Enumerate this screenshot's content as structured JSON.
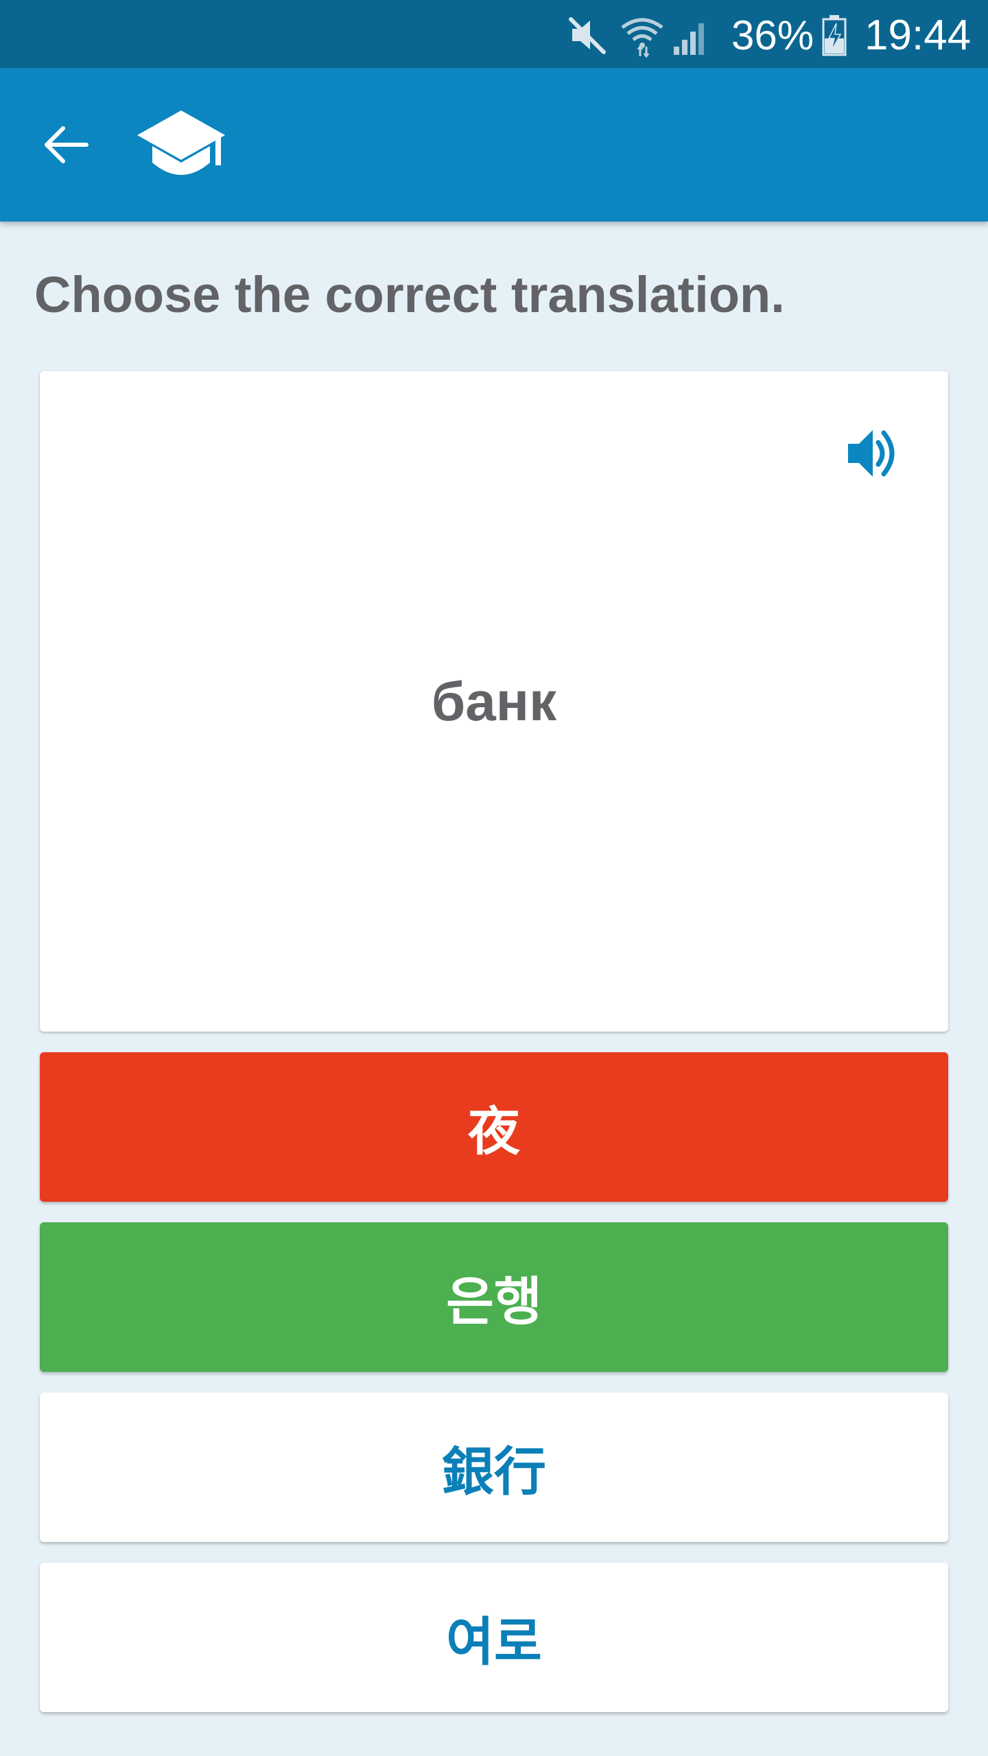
{
  "status_bar": {
    "battery_percent": "36%",
    "time": "19:44",
    "icons": [
      "mute-icon",
      "wifi-icon",
      "signal-icon",
      "battery-charging-icon"
    ]
  },
  "app_bar": {
    "back_icon": "arrow-back-icon",
    "logo_icon": "graduation-cap-icon"
  },
  "quiz": {
    "instruction": "Choose the correct translation.",
    "word": "банк",
    "speaker_icon": "speaker-icon",
    "options": [
      {
        "label": "夜",
        "state": "wrong"
      },
      {
        "label": "은행",
        "state": "correct"
      },
      {
        "label": "銀行",
        "state": "neutral"
      },
      {
        "label": "여로",
        "state": "neutral"
      }
    ]
  },
  "colors": {
    "status_bar": "#0a6690",
    "app_bar": "#0b86c0",
    "background": "#e6f1f7",
    "wrong": "#e93c1f",
    "correct": "#4caf50",
    "neutral_text": "#0b7fb8",
    "text_gray": "#626366"
  }
}
